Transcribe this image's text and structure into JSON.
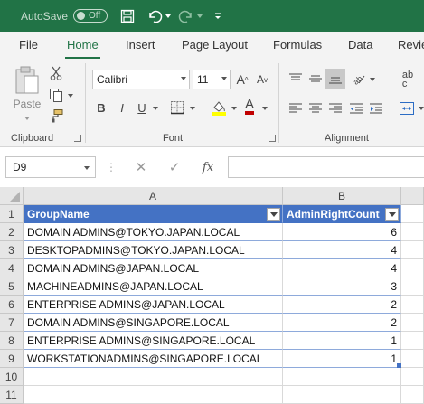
{
  "titlebar": {
    "autosave_label": "AutoSave",
    "autosave_state": "Off",
    "icons": [
      "save-icon",
      "undo-icon",
      "redo-icon",
      "customize-qat-icon"
    ]
  },
  "tabs": [
    "File",
    "Home",
    "Insert",
    "Page Layout",
    "Formulas",
    "Data",
    "Revie"
  ],
  "active_tab": "Home",
  "ribbon": {
    "clipboard": {
      "paste_label": "Paste",
      "group_label": "Clipboard"
    },
    "font": {
      "font_name": "Calibri",
      "font_size": "11",
      "group_label": "Font",
      "bold": "B",
      "italic": "I",
      "underline": "U",
      "font_color_letter": "A",
      "grow_label": "A",
      "shrink_label": "A"
    },
    "alignment": {
      "group_label": "Alignment",
      "wrap_label": "ab\nc"
    }
  },
  "formula_bar": {
    "name_box": "D9",
    "formula": "",
    "fx_label": "fx"
  },
  "columns": [
    "A",
    "B"
  ],
  "table": {
    "headers": [
      "GroupName",
      "AdminRightCount"
    ],
    "rows": [
      [
        "DOMAIN ADMINS@TOKYO.JAPAN.LOCAL",
        "6"
      ],
      [
        "DESKTOPADMINS@TOKYO.JAPAN.LOCAL",
        "4"
      ],
      [
        "DOMAIN ADMINS@JAPAN.LOCAL",
        "4"
      ],
      [
        "MACHINEADMINS@JAPAN.LOCAL",
        "3"
      ],
      [
        "ENTERPRISE ADMINS@JAPAN.LOCAL",
        "2"
      ],
      [
        "DOMAIN ADMINS@SINGAPORE.LOCAL",
        "2"
      ],
      [
        "ENTERPRISE ADMINS@SINGAPORE.LOCAL",
        "1"
      ],
      [
        "WORKSTATIONADMINS@SINGAPORE.LOCAL",
        "1"
      ]
    ]
  },
  "row_numbers": [
    "1",
    "2",
    "3",
    "4",
    "5",
    "6",
    "7",
    "8",
    "9",
    "10",
    "11"
  ],
  "colors": {
    "excel_green": "#217346",
    "table_header": "#4472c4",
    "font_color": "#c00000",
    "highlight": "#ffff00"
  }
}
